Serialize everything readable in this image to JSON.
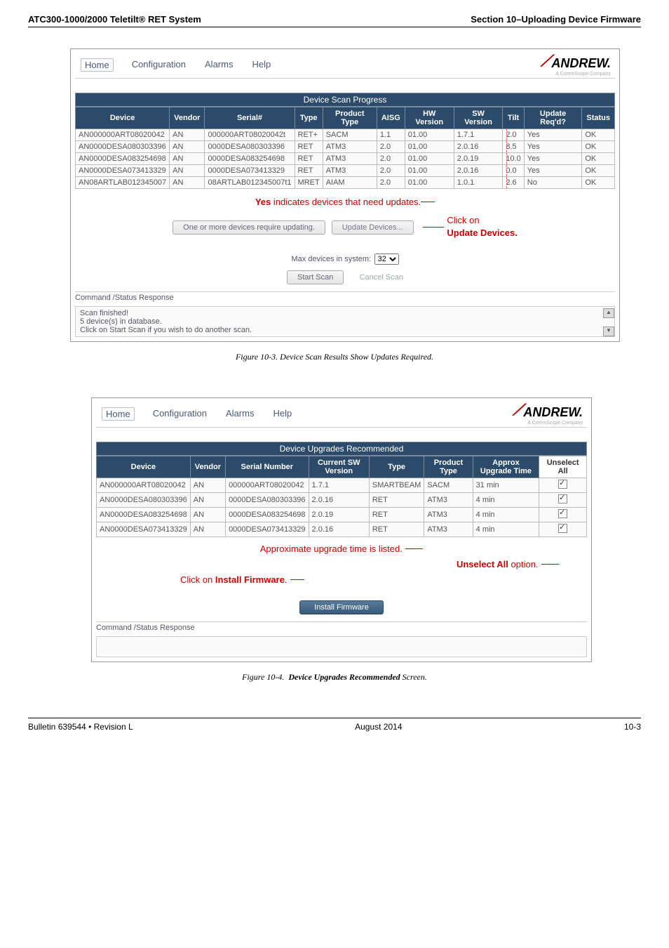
{
  "header": {
    "left": "ATC300-1000/2000 Teletilt® RET System",
    "right": "Section 10–Uploading Device Firmware"
  },
  "figure1": {
    "menu": [
      "Home",
      "Configuration",
      "Alarms",
      "Help"
    ],
    "brand": "ANDREW.",
    "brandSub": "A CommScope Company",
    "sectionTitle": "Device Scan Progress",
    "columns": [
      "Device",
      "Vendor",
      "Serial#",
      "Type",
      "Product Type",
      "AISG",
      "HW Version",
      "SW Version",
      "Tilt",
      "Update Req'd?",
      "Status"
    ],
    "rows": [
      {
        "device": "AN000000ART08020042",
        "vendor": "AN",
        "serial": "000000ART08020042t",
        "type": "RET+",
        "product": "SACM",
        "aisg": "1.1",
        "hw": "01.00",
        "sw": "1.7.1",
        "tilt": "2.0",
        "update": "Yes",
        "status": "OK"
      },
      {
        "device": "AN0000DESA080303396",
        "vendor": "AN",
        "serial": "0000DESA080303396",
        "type": "RET",
        "product": "ATM3",
        "aisg": "2.0",
        "hw": "01.00",
        "sw": "2.0.16",
        "tilt": "8.5",
        "update": "Yes",
        "status": "OK"
      },
      {
        "device": "AN0000DESA083254698",
        "vendor": "AN",
        "serial": "0000DESA083254698",
        "type": "RET",
        "product": "ATM3",
        "aisg": "2.0",
        "hw": "01.00",
        "sw": "2.0.19",
        "tilt": "10.0",
        "update": "Yes",
        "status": "OK"
      },
      {
        "device": "AN0000DESA073413329",
        "vendor": "AN",
        "serial": "0000DESA073413329",
        "type": "RET",
        "product": "ATM3",
        "aisg": "2.0",
        "hw": "01.00",
        "sw": "2.0.16",
        "tilt": "0.0",
        "update": "Yes",
        "status": "OK"
      },
      {
        "device": "AN08ARTLAB012345007",
        "vendor": "AN",
        "serial": "08ARTLAB012345007t1",
        "type": "MRET",
        "product": "AIAM",
        "aisg": "2.0",
        "hw": "01.00",
        "sw": "1.0.1",
        "tilt": "2.6",
        "update": "No",
        "status": "OK"
      }
    ],
    "calloutYes": "Yes indicates devices that need updates.",
    "calloutClick": "Click on",
    "calloutUpdate": "Update Devices.",
    "updateBtn": "One or more devices require updating.",
    "updateDevicesLabel": "Update Devices.",
    "maxDevices": "Max devices in system:",
    "maxDevicesVal": "32",
    "startScan": "Start Scan",
    "cancelScan": "Cancel Scan",
    "commandBar": "Command /Status Response",
    "log": [
      "Scan finished!",
      "5 device(s) in database.",
      "Click on Start Scan if you wish to do another scan."
    ],
    "caption": "Figure 10-3.  Device Scan Results Show Updates Required."
  },
  "figure2": {
    "menu": [
      "Home",
      "Configuration",
      "Alarms",
      "Help"
    ],
    "brand": "ANDREW.",
    "brandSub": "A CommScope Company",
    "sectionTitle": "Device Upgrades Recommended",
    "columns": [
      "Device",
      "Vendor",
      "Serial Number",
      "Current SW Version",
      "Type",
      "Product Type",
      "Approx Upgrade Time",
      "Unselect All"
    ],
    "rows": [
      {
        "device": "AN000000ART08020042",
        "vendor": "AN",
        "serial": "000000ART08020042",
        "cur": "1.7.1",
        "type": "SMARTBEAM",
        "prod": "SACM",
        "time": "31 min",
        "chk": true
      },
      {
        "device": "AN0000DESA080303396",
        "vendor": "AN",
        "serial": "0000DESA080303396",
        "cur": "2.0.16",
        "type": "RET",
        "prod": "ATM3",
        "time": "4 min",
        "chk": true
      },
      {
        "device": "AN0000DESA083254698",
        "vendor": "AN",
        "serial": "0000DESA083254698",
        "cur": "2.0.19",
        "type": "RET",
        "prod": "ATM3",
        "time": "4 min",
        "chk": true
      },
      {
        "device": "AN0000DESA073413329",
        "vendor": "AN",
        "serial": "0000DESA073413329",
        "cur": "2.0.16",
        "type": "RET",
        "prod": "ATM3",
        "time": "4 min",
        "chk": true
      }
    ],
    "calloutTime": "Approximate upgrade time is listed.",
    "calloutUnselect": "Unselect All option.",
    "calloutInstall": "Click on Install Firmware.",
    "installBtn": "Install Firmware",
    "commandBar": "Command /Status Response",
    "caption": "Figure 10-4.  Device Upgrades Recommended Screen."
  },
  "footer": {
    "left": "Bulletin 639544  •  Revision L",
    "center": "August 2014",
    "right": "10-3"
  }
}
